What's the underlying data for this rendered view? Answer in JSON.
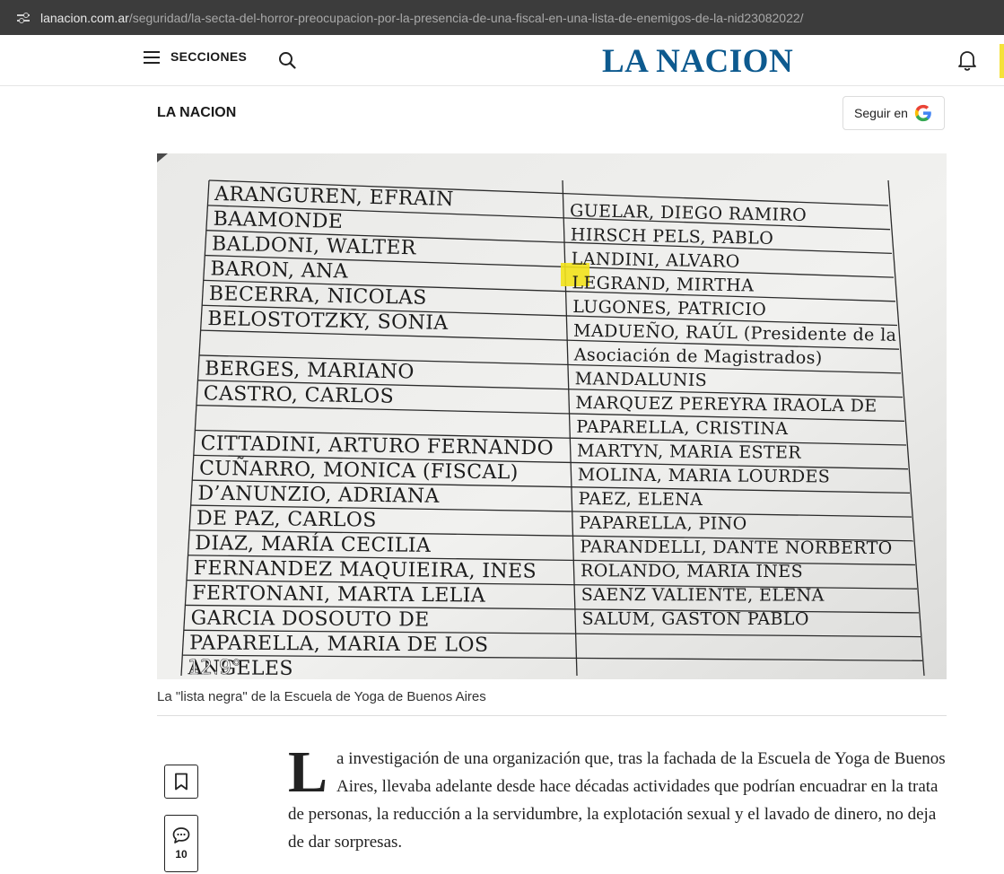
{
  "browser": {
    "url_domain": "lanacion.com.ar",
    "url_path": "/seguridad/la-secta-del-horror-preocupacion-por-la-presencia-de-una-fiscal-en-una-lista-de-enemigos-de-la-nid23082022/"
  },
  "header": {
    "menu_label": "SECCIONES",
    "logo_text": "LA NACION",
    "brand_color": "#0d5a8f"
  },
  "section": {
    "title": "LA NACION",
    "follow_label": "Seguir en"
  },
  "photo": {
    "left_column": [
      "ARANGUREN, EFRAIN",
      "BAAMONDE",
      "BALDONI, WALTER",
      "BARON, ANA",
      "BECERRA, NICOLAS",
      "BELOSTOTZKY, SONIA",
      "",
      "BERGES, MARIANO",
      "CASTRO, CARLOS",
      "",
      "CITTADINI, ARTURO FERNANDO",
      "CUÑARRO, MONICA (FISCAL)",
      "D’ANUNZIO, ADRIANA",
      "DE PAZ, CARLOS",
      "DIAZ, MARÍA CECILIA",
      "FERNANDEZ MAQUIEIRA, INES",
      "FERTONANI, MARTA LELIA",
      "GARCIA DOSOUTO DE",
      "PAPARELLA, MARIA DE LOS",
      "ANGELES"
    ],
    "right_column": [
      "GUELAR, DIEGO RAMIRO",
      "HIRSCH PELS, PABLO",
      "LANDINI, ALVARO",
      "LEGRAND, MIRTHA",
      "LUGONES, PATRICIO",
      "MADUEÑO, RAÚL (Presidente de la",
      "Asociación de Magistrados)",
      "MANDALUNIS",
      "MARQUEZ PEREYRA IRAOLA DE",
      "PAPARELLA, CRISTINA",
      "MARTYN, MARIA ESTER",
      "MOLINA, MARIA LOURDES",
      "PAEZ, ELENA",
      "PAPARELLA, PINO",
      "PARANDELLI, DANTE NORBERTO",
      "ROLANDO, MARIA INES",
      "SAENZ VALIENTE, ELENA",
      "SALUM, GASTON PABLO",
      "",
      ""
    ],
    "overlay_temperature": "12.9°",
    "highlight_color": "#f2e21b"
  },
  "caption": "La \"lista negra\" de la Escuela de Yoga de Buenos Aires",
  "share": {
    "comment_count": "10"
  },
  "article": {
    "dropcap": "L",
    "paragraph_rest": "a investigación de una organización que, tras la fachada de la Escuela de Yoga de Buenos Aires, llevaba adelante desde hace décadas actividades que podrían encuadrar en la trata de personas, la reducción a la servidumbre, la explotación sexual y el lavado de dinero, no deja de dar sorpresas."
  }
}
